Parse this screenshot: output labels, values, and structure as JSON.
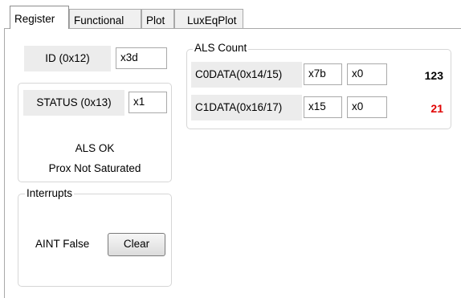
{
  "tabs": [
    {
      "label": "Register"
    },
    {
      "label": "Functional"
    },
    {
      "label": "Plot"
    },
    {
      "label": "LuxEqPlot"
    }
  ],
  "id_reg": {
    "label": "ID (0x12)",
    "value": "x3d"
  },
  "status_reg": {
    "label": "STATUS (0x13)",
    "value": "x1",
    "als_status": "ALS OK",
    "prox_status": "Prox Not Saturated"
  },
  "interrupts": {
    "title": "Interrupts",
    "aint_label": "AINT False",
    "clear_label": "Clear"
  },
  "als_count": {
    "title": "ALS Count",
    "rows": [
      {
        "label": "C0DATA(0x14/15)",
        "high": "x7b",
        "low": "x0",
        "count": "123",
        "count_color": "#000000"
      },
      {
        "label": "C1DATA(0x16/17)",
        "high": "x15",
        "low": "x0",
        "count": "21",
        "count_color": "#e00000"
      }
    ]
  }
}
